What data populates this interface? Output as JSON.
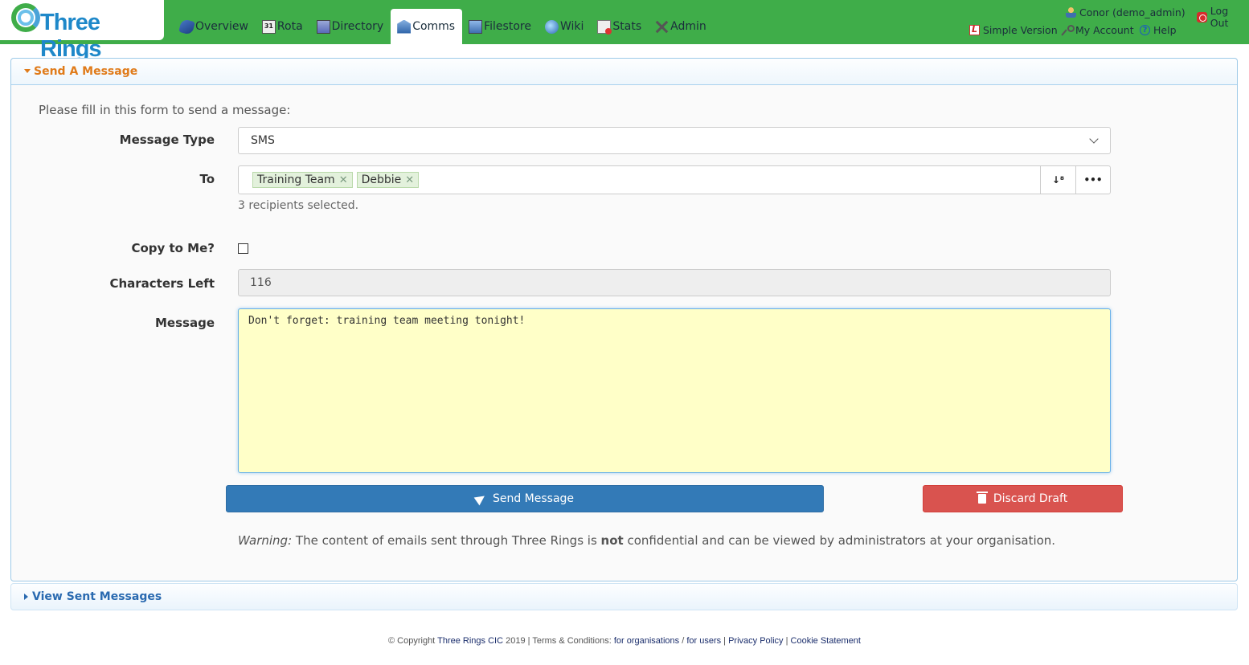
{
  "app": {
    "logo_text": "Three Rings"
  },
  "nav": [
    {
      "label": "Overview",
      "icon": "overview-icon"
    },
    {
      "label": "Rota",
      "icon": "calendar-icon",
      "icon_text": "31"
    },
    {
      "label": "Directory",
      "icon": "directory-icon"
    },
    {
      "label": "Comms",
      "icon": "comms-icon",
      "active": true
    },
    {
      "label": "Filestore",
      "icon": "filestore-icon"
    },
    {
      "label": "Wiki",
      "icon": "wiki-icon"
    },
    {
      "label": "Stats",
      "icon": "stats-icon"
    },
    {
      "label": "Admin",
      "icon": "admin-icon"
    }
  ],
  "user": {
    "name": "Conor (demo_admin)",
    "logout": "Log Out",
    "simple_version": "Simple Version",
    "my_account": "My Account",
    "help": "Help"
  },
  "send_panel": {
    "title": "Send A Message",
    "intro": "Please fill in this form to send a message:",
    "message_type": {
      "label": "Message Type",
      "value": "SMS"
    },
    "to": {
      "label": "To",
      "tags": [
        "Training Team",
        "Debbie"
      ],
      "help": "3 recipients selected."
    },
    "copy_to_me": {
      "label": "Copy to Me?",
      "checked": false
    },
    "chars_left": {
      "label": "Characters Left",
      "value": "116"
    },
    "message": {
      "label": "Message",
      "value": "Don't forget: training team meeting tonight!"
    },
    "send_label": "Send Message",
    "discard_label": "Discard Draft",
    "warning": {
      "prefix": "Warning:",
      "part1": " The content of emails sent through Three Rings is ",
      "bold": "not",
      "part2": " confidential and can be viewed by administrators at your organisation."
    }
  },
  "sent_panel": {
    "title": "View Sent Messages"
  },
  "footer": {
    "copyright": "© Copyright ",
    "org": "Three Rings CIC",
    "year": " 2019 | Terms & Conditions: ",
    "for_orgs": "for organisations",
    "slash": " / ",
    "for_users": "for users",
    "sep1": " | ",
    "privacy": "Privacy Policy",
    "sep2": " | ",
    "cookies": "Cookie Statement"
  },
  "colors": {
    "header_green": "#3fad49",
    "accent_orange": "#e07b1a",
    "primary_blue": "#337ab7",
    "danger_red": "#d9534f",
    "message_bg": "#ffffc8"
  }
}
